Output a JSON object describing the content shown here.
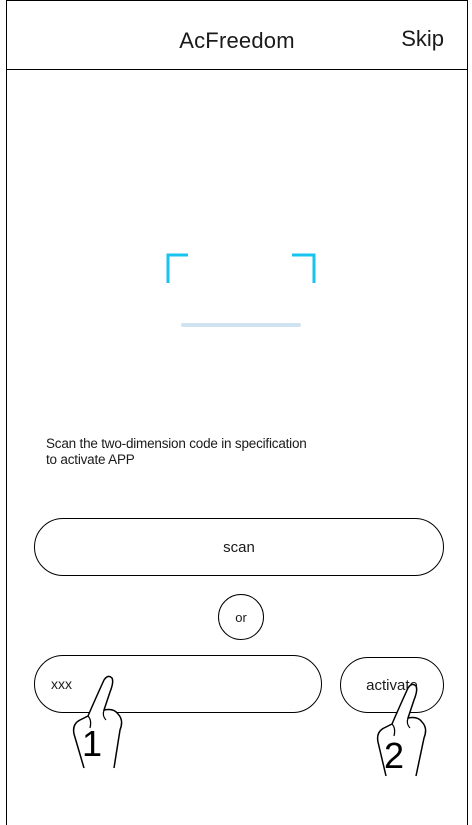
{
  "header": {
    "title": "AcFreedom",
    "skip_label": "Skip"
  },
  "scanner": {
    "icon": "qr-scan-frame-icon",
    "accent_color": "#19c3f0"
  },
  "instruction_line1": "Scan the two-dimension code in specification",
  "instruction_line2": "to activate APP",
  "scan_button": {
    "label": "scan"
  },
  "or_label": "or",
  "code_input": {
    "value": "xxx"
  },
  "activate_button": {
    "label": "activate"
  },
  "hints": [
    {
      "icon": "pointing-hand-icon",
      "number": "1"
    },
    {
      "icon": "pointing-hand-icon",
      "number": "2"
    }
  ]
}
